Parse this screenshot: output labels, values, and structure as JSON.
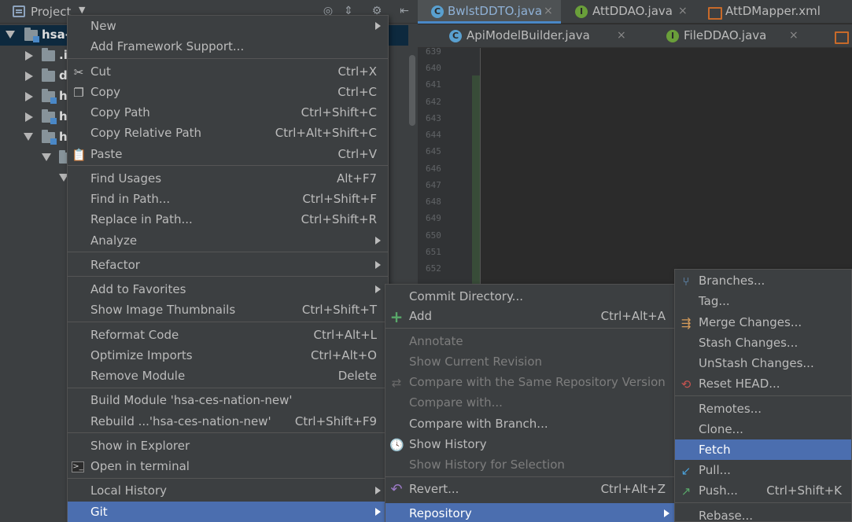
{
  "project_panel": {
    "title": "Project",
    "tree": [
      {
        "label": "hsa-",
        "expanded": true
      },
      {
        "label": ".i",
        "expanded": false
      },
      {
        "label": "d",
        "expanded": false
      },
      {
        "label": "h",
        "expanded": false
      },
      {
        "label": "h",
        "expanded": false
      },
      {
        "label": "h",
        "expanded": true
      },
      {
        "label": "",
        "expanded": true
      },
      {
        "label": "",
        "expanded": true
      }
    ]
  },
  "tabs": {
    "row1": [
      {
        "label": "BwlstDDTO.java",
        "icon": "class-icon",
        "active": true
      },
      {
        "label": "AttDDAO.java",
        "icon": "interface-icon",
        "active": false
      },
      {
        "label": "AttDMapper.xml",
        "icon": "xml-icon",
        "active": false
      }
    ],
    "row2": [
      {
        "label": "ApiModelBuilder.java",
        "icon": "class-icon"
      },
      {
        "label": "FileDDAO.java",
        "icon": "interface-icon"
      }
    ],
    "close_glyph": "×"
  },
  "editor": {
    "line_numbers": [
      "639",
      "640",
      "641",
      "642",
      "643",
      "644",
      "645",
      "646",
      "647",
      "648",
      "649",
      "650",
      "651",
      "652"
    ]
  },
  "main_menu": {
    "items": [
      {
        "label": "New",
        "shortcut": "",
        "submenu": true
      },
      {
        "label": "Add Framework Support...",
        "shortcut": ""
      },
      {
        "label": "Cut",
        "shortcut": "Ctrl+X",
        "icon": "scissors-icon"
      },
      {
        "label": "Copy",
        "shortcut": "Ctrl+C",
        "icon": "copy-icon"
      },
      {
        "label": "Copy Path",
        "shortcut": "Ctrl+Shift+C"
      },
      {
        "label": "Copy Relative Path",
        "shortcut": "Ctrl+Alt+Shift+C"
      },
      {
        "label": "Paste",
        "shortcut": "Ctrl+V",
        "icon": "paste-icon"
      },
      {
        "label": "Find Usages",
        "shortcut": "Alt+F7"
      },
      {
        "label": "Find in Path...",
        "shortcut": "Ctrl+Shift+F"
      },
      {
        "label": "Replace in Path...",
        "shortcut": "Ctrl+Shift+R"
      },
      {
        "label": "Analyze",
        "shortcut": "",
        "submenu": true
      },
      {
        "label": "Refactor",
        "shortcut": "",
        "submenu": true
      },
      {
        "label": "Add to Favorites",
        "shortcut": "",
        "submenu": true
      },
      {
        "label": "Show Image Thumbnails",
        "shortcut": "Ctrl+Shift+T"
      },
      {
        "label": "Reformat Code",
        "shortcut": "Ctrl+Alt+L"
      },
      {
        "label": "Optimize Imports",
        "shortcut": "Ctrl+Alt+O"
      },
      {
        "label": "Remove Module",
        "shortcut": "Delete"
      },
      {
        "label": "Build Module 'hsa-ces-nation-new'",
        "shortcut": ""
      },
      {
        "label": "Rebuild ...'hsa-ces-nation-new'",
        "shortcut": "Ctrl+Shift+F9"
      },
      {
        "label": "Show in Explorer",
        "shortcut": ""
      },
      {
        "label": "Open in terminal",
        "shortcut": "",
        "icon": "terminal-icon"
      },
      {
        "label": "Local History",
        "shortcut": "",
        "submenu": true
      },
      {
        "label": "Git",
        "shortcut": "",
        "submenu": true,
        "highlighted": true
      }
    ]
  },
  "git_menu": {
    "items": [
      {
        "label": "Commit Directory...",
        "shortcut": ""
      },
      {
        "label": "Add",
        "shortcut": "Ctrl+Alt+A",
        "icon": "plus-icon"
      },
      {
        "label": "Annotate",
        "shortcut": "",
        "disabled": true
      },
      {
        "label": "Show Current Revision",
        "shortcut": "",
        "disabled": true
      },
      {
        "label": "Compare with the Same Repository Version",
        "shortcut": "",
        "disabled": true,
        "icon": "compare-icon"
      },
      {
        "label": "Compare with...",
        "shortcut": "",
        "disabled": true
      },
      {
        "label": "Compare with Branch...",
        "shortcut": ""
      },
      {
        "label": "Show History",
        "shortcut": "",
        "icon": "history-icon"
      },
      {
        "label": "Show History for Selection",
        "shortcut": "",
        "disabled": true
      },
      {
        "label": "Revert...",
        "shortcut": "Ctrl+Alt+Z",
        "icon": "revert-icon"
      },
      {
        "label": "Repository",
        "shortcut": "",
        "submenu": true,
        "highlighted": true
      }
    ]
  },
  "repo_menu": {
    "items": [
      {
        "label": "Branches...",
        "shortcut": "",
        "icon": "branches-icon"
      },
      {
        "label": "Tag...",
        "shortcut": ""
      },
      {
        "label": "Merge Changes...",
        "shortcut": "",
        "icon": "merge-icon"
      },
      {
        "label": "Stash Changes...",
        "shortcut": ""
      },
      {
        "label": "UnStash Changes...",
        "shortcut": ""
      },
      {
        "label": "Reset HEAD...",
        "shortcut": "",
        "icon": "reset-icon"
      },
      {
        "label": "Remotes...",
        "shortcut": ""
      },
      {
        "label": "Clone...",
        "shortcut": ""
      },
      {
        "label": "Fetch",
        "shortcut": "",
        "highlighted": true
      },
      {
        "label": "Pull...",
        "shortcut": "",
        "icon": "pull-icon"
      },
      {
        "label": "Push...",
        "shortcut": "Ctrl+Shift+K",
        "icon": "push-icon"
      },
      {
        "label": "Rebase...",
        "shortcut": ""
      }
    ]
  },
  "colors": {
    "panel_bg": "#3c3f41",
    "editor_bg": "#2b2b2b",
    "highlight": "#4b6eaf",
    "text": "#bbbbbb",
    "disabled_text": "#7d7d7d"
  }
}
